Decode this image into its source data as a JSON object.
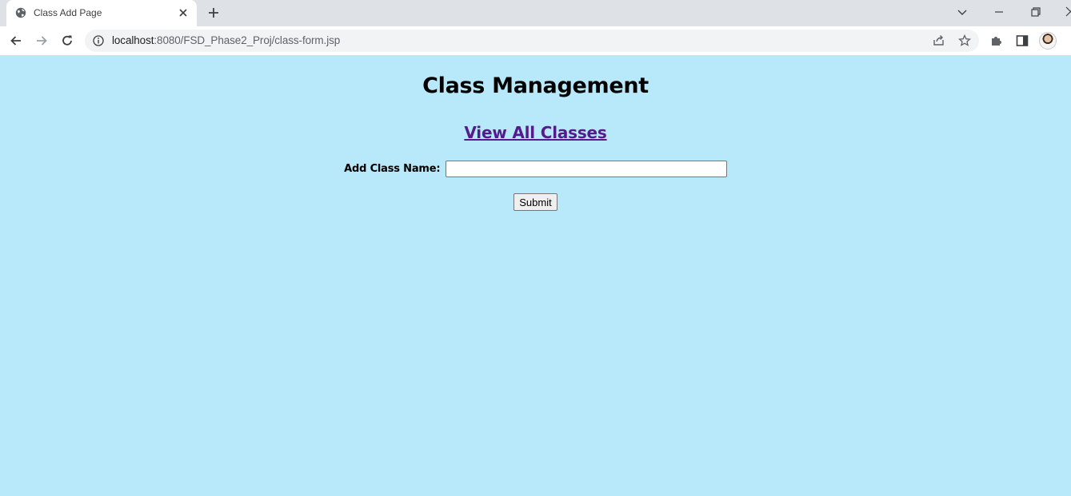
{
  "browser": {
    "tab_title": "Class Add Page",
    "url_host": "localhost",
    "url_rest": ":8080/FSD_Phase2_Proj/class-form.jsp"
  },
  "page": {
    "heading": "Class Management",
    "view_all_link": "View All Classes",
    "field_label": "Add Class Name:",
    "field_value": "",
    "field_placeholder": "",
    "submit_label": "Submit"
  },
  "colors": {
    "page_background": "#b7e9fa",
    "link_visited": "#551a8b"
  },
  "icons": {
    "favicon": "globe-icon",
    "tab_close": "close-icon",
    "new_tab": "plus-icon",
    "back": "back-arrow-icon",
    "forward": "forward-arrow-icon",
    "reload": "reload-icon",
    "site_info": "info-icon",
    "share": "share-icon",
    "bookmark": "star-icon",
    "extensions": "puzzle-icon",
    "side_panel": "side-panel-icon",
    "profile": "avatar"
  }
}
